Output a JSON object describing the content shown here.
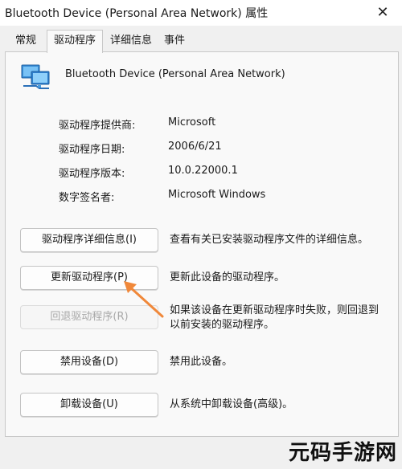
{
  "window": {
    "title": "Bluetooth Device (Personal Area Network) 属性",
    "close_glyph": "✕"
  },
  "tabs": [
    {
      "label": "常规",
      "active": false
    },
    {
      "label": "驱动程序",
      "active": true
    },
    {
      "label": "详细信息",
      "active": false
    },
    {
      "label": "事件",
      "active": false
    }
  ],
  "device": {
    "name": "Bluetooth Device (Personal Area Network)",
    "icon": "network-adapter-icon"
  },
  "info": [
    {
      "label": "驱动程序提供商:",
      "value": "Microsoft"
    },
    {
      "label": "驱动程序日期:",
      "value": "2006/6/21"
    },
    {
      "label": "驱动程序版本:",
      "value": "10.0.22000.1"
    },
    {
      "label": "数字签名者:",
      "value": "Microsoft Windows"
    }
  ],
  "actions": [
    {
      "button": "驱动程序详细信息(I)",
      "description": "查看有关已安装驱动程序文件的详细信息。",
      "enabled": true
    },
    {
      "button": "更新驱动程序(P)",
      "description": "更新此设备的驱动程序。",
      "enabled": true
    },
    {
      "button": "回退驱动程序(R)",
      "description": "如果该设备在更新驱动程序时失败，则回退到以前安装的驱动程序。",
      "enabled": false
    },
    {
      "button": "禁用设备(D)",
      "description": "禁用此设备。",
      "enabled": true
    },
    {
      "button": "卸载设备(U)",
      "description": "从系统中卸载设备(高级)。",
      "enabled": true
    }
  ],
  "annotation": {
    "color": "#f0883a",
    "points_to": "更新驱动程序(P)"
  },
  "watermark": {
    "text": "元码手游网"
  }
}
